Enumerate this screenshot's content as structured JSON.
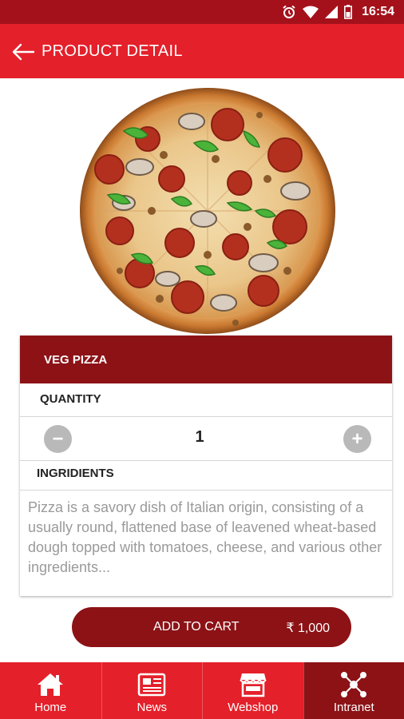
{
  "status_bar": {
    "time": "16:54"
  },
  "app_bar": {
    "title": "PRODUCT DETAIL"
  },
  "product": {
    "name": "VEG PIZZA",
    "quantity_label": "QUANTITY",
    "quantity": "1",
    "decrement": "−",
    "increment": "+",
    "ingredients_label": "INGRIDIENTS",
    "description": "Pizza is a savory dish of Italian origin, consisting of a usually round, flattened base of leavened wheat-based dough topped with tomatoes, cheese, and various other ingredients..."
  },
  "cart": {
    "label": "ADD TO CART",
    "price": "₹ 1,000"
  },
  "bottom_nav": {
    "items": [
      {
        "label": "Home",
        "icon": "home-icon"
      },
      {
        "label": "News",
        "icon": "newspaper-icon"
      },
      {
        "label": "Webshop",
        "icon": "shop-icon"
      },
      {
        "label": "Intranet",
        "icon": "network-icon",
        "active": true
      }
    ]
  },
  "colors": {
    "status_bar": "#a4111b",
    "app_bar": "#e4202a",
    "accent_dark": "#8c1216",
    "text_muted": "#9a9a9a"
  }
}
